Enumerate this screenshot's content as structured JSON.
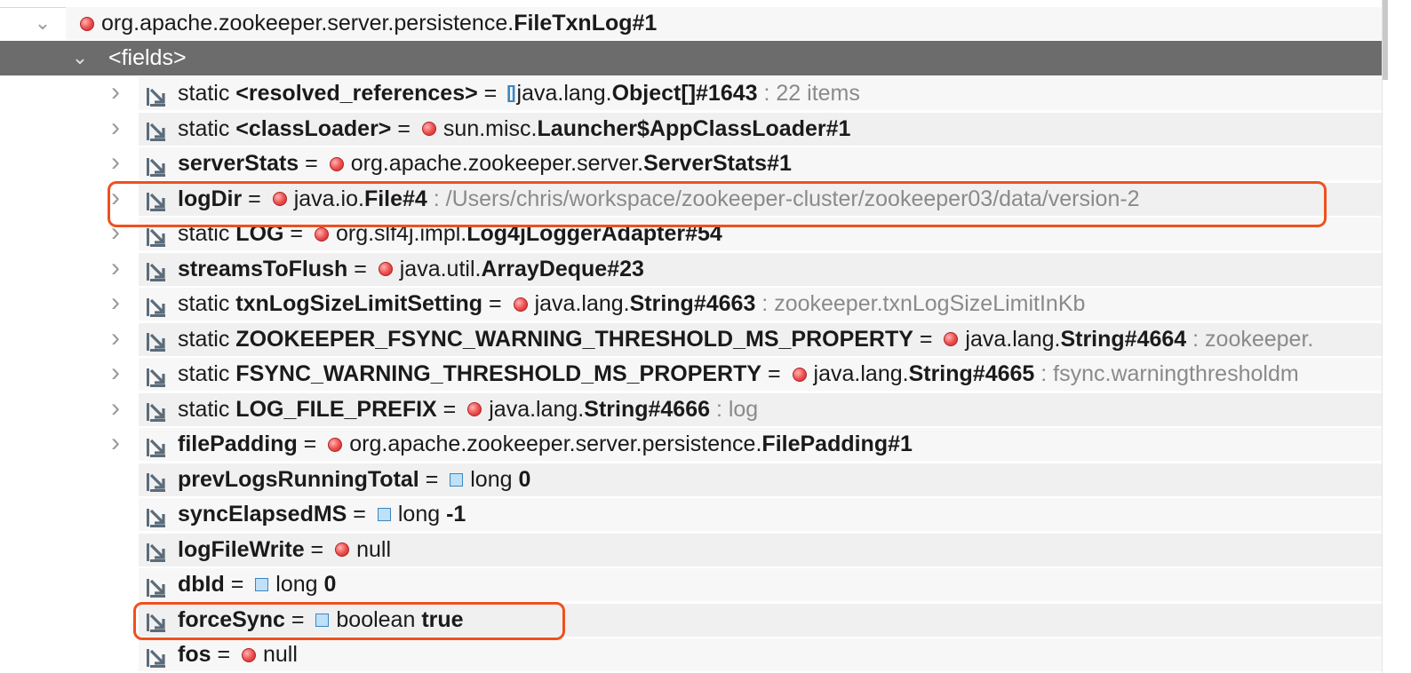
{
  "root": {
    "chevron": "⌄",
    "type_prefix": "org.apache.zookeeper.server.persistence.",
    "type_name": "FileTxnLog#1"
  },
  "fields_node": {
    "label": "<fields>"
  },
  "rows": [
    {
      "mod": "static ",
      "name": "<resolved_references>",
      "eq": " = ",
      "kind": "array",
      "type_prefix": "java.lang.",
      "type_name": "Object[]#1643",
      "note": " : 22 items",
      "expandable": true
    },
    {
      "mod": "static ",
      "name": "<classLoader>",
      "eq": " = ",
      "kind": "object",
      "type_prefix": "sun.misc.",
      "type_name": "Launcher$AppClassLoader#1",
      "note": "",
      "expandable": true
    },
    {
      "mod": "",
      "name": "serverStats",
      "eq": " = ",
      "kind": "object",
      "type_prefix": "org.apache.zookeeper.server.",
      "type_name": "ServerStats#1",
      "note": "",
      "expandable": true
    },
    {
      "mod": "",
      "name": "logDir",
      "eq": " = ",
      "kind": "object",
      "type_prefix": "java.io.",
      "type_name": "File#4",
      "note": " : /Users/chris/workspace/zookeeper-cluster/zookeeper03/data/version-2",
      "expandable": true
    },
    {
      "mod": "static ",
      "name": "LOG",
      "eq": " = ",
      "kind": "object",
      "type_prefix": "org.slf4j.impl.",
      "type_name": "Log4jLoggerAdapter#54",
      "note": "",
      "expandable": true
    },
    {
      "mod": "",
      "name": "streamsToFlush",
      "eq": " = ",
      "kind": "object",
      "type_prefix": "java.util.",
      "type_name": "ArrayDeque#23",
      "note": "",
      "expandable": true
    },
    {
      "mod": "static ",
      "name": "txnLogSizeLimitSetting",
      "eq": " = ",
      "kind": "object",
      "type_prefix": "java.lang.",
      "type_name": "String#4663",
      "note": " : zookeeper.txnLogSizeLimitInKb",
      "expandable": true
    },
    {
      "mod": "static ",
      "name": "ZOOKEEPER_FSYNC_WARNING_THRESHOLD_MS_PROPERTY",
      "eq": " = ",
      "kind": "object",
      "type_prefix": "java.lang.",
      "type_name": "String#4664",
      "note": " : zookeeper.",
      "expandable": true
    },
    {
      "mod": "static ",
      "name": "FSYNC_WARNING_THRESHOLD_MS_PROPERTY",
      "eq": " = ",
      "kind": "object",
      "type_prefix": "java.lang.",
      "type_name": "String#4665",
      "note": " : fsync.warningthresholdm",
      "expandable": true
    },
    {
      "mod": "static ",
      "name": "LOG_FILE_PREFIX",
      "eq": " = ",
      "kind": "object",
      "type_prefix": "java.lang.",
      "type_name": "String#4666",
      "note": " : log",
      "expandable": true
    },
    {
      "mod": "",
      "name": "filePadding",
      "eq": " = ",
      "kind": "object",
      "type_prefix": "org.apache.zookeeper.server.persistence.",
      "type_name": "FilePadding#1",
      "note": "",
      "expandable": true
    },
    {
      "mod": "",
      "name": "prevLogsRunningTotal",
      "eq": " = ",
      "kind": "primitive",
      "type_prefix": "long ",
      "type_name": "0",
      "note": "",
      "expandable": false
    },
    {
      "mod": "",
      "name": "syncElapsedMS",
      "eq": " = ",
      "kind": "primitive",
      "type_prefix": "long ",
      "type_name": "-1",
      "note": "",
      "expandable": false
    },
    {
      "mod": "",
      "name": "logFileWrite",
      "eq": " = ",
      "kind": "object",
      "type_prefix": "null",
      "type_name": "",
      "note": "",
      "expandable": false
    },
    {
      "mod": "",
      "name": "dbId",
      "eq": " = ",
      "kind": "primitive",
      "type_prefix": "long ",
      "type_name": "0",
      "note": "",
      "expandable": false
    },
    {
      "mod": "",
      "name": "forceSync",
      "eq": " = ",
      "kind": "primitive",
      "type_prefix": "boolean ",
      "type_name": "true",
      "note": "",
      "expandable": false
    },
    {
      "mod": "",
      "name": "fos",
      "eq": " = ",
      "kind": "object",
      "type_prefix": "null",
      "type_name": "",
      "note": "",
      "expandable": false
    }
  ],
  "highlights": [
    "logDir",
    "forceSync"
  ],
  "colors": {
    "highlight": "#f0501e",
    "selected_row": "#6c6c6c",
    "object_dot": "#ec4b4b",
    "primitive_square": "#3a86c2"
  }
}
